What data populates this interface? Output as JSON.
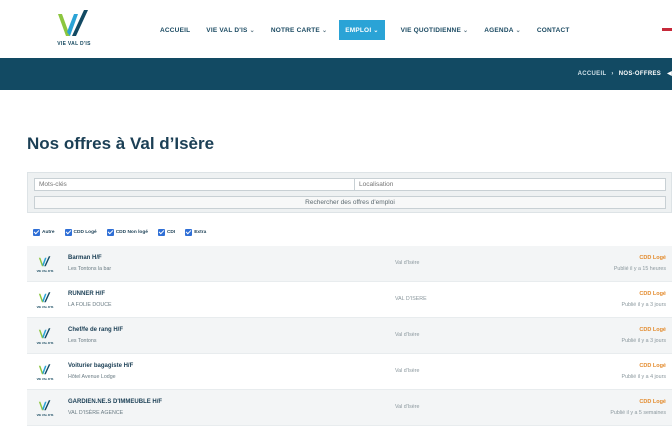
{
  "header": {
    "logo_text": "VIE VAL D'IS",
    "nav": [
      {
        "label": "ACCUEIL",
        "has_menu": false,
        "active": false
      },
      {
        "label": "VIE VAL D'IS",
        "has_menu": true,
        "active": false
      },
      {
        "label": "NOTRE CARTE",
        "has_menu": true,
        "active": false
      },
      {
        "label": "EMPLOI",
        "has_menu": true,
        "active": true
      },
      {
        "label": "VIE QUOTIDIENNE",
        "has_menu": true,
        "active": false
      },
      {
        "label": "AGENDA",
        "has_menu": true,
        "active": false
      },
      {
        "label": "CONTACT",
        "has_menu": false,
        "active": false
      }
    ]
  },
  "breadcrumb": {
    "home": "ACCUEIL",
    "separator": "›",
    "current": "NOS-OFFRES",
    "arrow": "◀"
  },
  "page": {
    "title": "Nos offres à Val d’Isère"
  },
  "search": {
    "keyword_placeholder": "Mots-clés",
    "location_placeholder": "Localisation",
    "button_label": "Rechercher des offres d'emploi"
  },
  "filters": [
    {
      "label": "Autre",
      "checked": true
    },
    {
      "label": "CDD Logé",
      "checked": true
    },
    {
      "label": "CDD Non logé",
      "checked": true
    },
    {
      "label": "CDI",
      "checked": true
    },
    {
      "label": "Extra",
      "checked": true
    }
  ],
  "jobs": [
    {
      "title": "Barman H/F",
      "company": "Les Tontons la bar",
      "location": "Val d'Isère",
      "housing": "CDD Logé",
      "published": "Publié il y a 15 heures"
    },
    {
      "title": "RUNNER H/F",
      "company": "LA FOLIE DOUCE",
      "location": "VAL D'ISERE",
      "housing": "CDD Logé",
      "published": "Publié il y a 3 jours"
    },
    {
      "title": "Chef/fe de rang H/F",
      "company": "Les Tontons",
      "location": "Val d'Isère",
      "housing": "CDD Logé",
      "published": "Publié il y a 3 jours"
    },
    {
      "title": "Voiturier bagagiste H/F",
      "company": "Hôtel Avenue Lodge",
      "location": "Val d'Isère",
      "housing": "CDD Logé",
      "published": "Publié il y a 4 jours"
    },
    {
      "title": "GARDIEN.NE.S D'IMMEUBLE H/F",
      "company": "VAL D'ISÈRE AGENCE",
      "location": "Val d'Isère",
      "housing": "CDD Logé",
      "published": "Publié il y a 5 semaines"
    }
  ],
  "colors": {
    "brand_dark": "#124a63",
    "accent_blue": "#2aa3d6",
    "logo_green": "#8cc63f",
    "housing_orange": "#e38b2d",
    "checkbox_blue": "#2f6fd6"
  },
  "icons": {
    "logo": "vvd-logo-icon",
    "checkbox": "checkbox-checked-icon",
    "flag": "flag-icon"
  }
}
